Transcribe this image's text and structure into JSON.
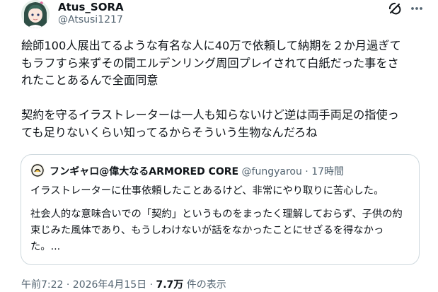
{
  "author": {
    "display_name": "Atus_SORA",
    "handle": "@Atsusi1217",
    "avatar_icon": "anime-girl-avatar-icon"
  },
  "header_actions": {
    "grok_icon": "grok-icon",
    "more_icon": "more-icon"
  },
  "tweet": {
    "paragraph1": [
      "絵師100人展出てるような有名な人に40万で依頼して納期を２か月過ぎて",
      "もラフすら来ずその間エルデンリング周回プレイされて白紙だった事をさ",
      "れたことあるんで全面同意"
    ],
    "paragraph2": [
      "契約を守るイラストレーターは一人も知らないけど逆は両手両足の指使っ",
      "ても足りないくらい知ってるからそういう生物なんだろね"
    ]
  },
  "quote": {
    "avatar_icon": "quoted-user-avatar-icon",
    "display_name": "フンギャロ@偉大なるARMORED CORE",
    "meta": " @fungyarou · 17時間",
    "line1": "イラストレーターに仕事依頼したことあるけど、非常にやり取りに苦心した。",
    "line2": "社会人的な意味合いでの「契約」というものをまったく理解しておらず、子供の約",
    "line3": "束じみた風体であり、もうしわけないが話をなかったことにせざるを得なかっ",
    "line4": "た。..."
  },
  "footer": {
    "timestamp": "午前7:22 · 2026年4月15日 · ",
    "views_count": "7.7万",
    "views_label": " 件の表示"
  },
  "colors": {
    "text_primary": "#0f1419",
    "text_secondary": "#536471",
    "border": "#cfd9de"
  }
}
